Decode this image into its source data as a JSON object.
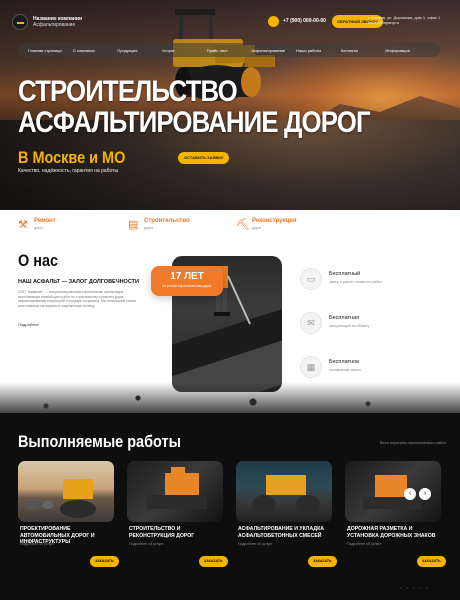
{
  "brand": {
    "name": "Название компании",
    "tagline": "Асфальтирование"
  },
  "header": {
    "phone": "+7 (900) 000-00-00",
    "call_button": "ОБРАТНЫЙ ЗВОНОК",
    "address": "г. Москва, ул. Дорожная, дом 1, офис 1\ninfo@company.ru"
  },
  "nav": [
    "Главная страница",
    "О компании",
    "Продукция",
    "Услуги",
    "Прайс-лист",
    "Асфальтирование",
    "Наши работы",
    "Контакты",
    "Информация"
  ],
  "hero": {
    "title_line1": "СТРОИТЕЛЬСТВО",
    "title_line2": "АСФАЛЬТИРОВАНИЕ ДОРОГ",
    "subtitle": "В Москве и МО",
    "order_button": "ОСТАВИТЬ ЗАЯВКУ",
    "tagline": "Качество, надёжность, гарантия на работы"
  },
  "features": [
    {
      "title": "Ремонт",
      "sub": "дорог",
      "icon": "hammer-icon"
    },
    {
      "title": "Строительство",
      "sub": "дорог",
      "icon": "road-icon"
    },
    {
      "title": "Реконструкция",
      "sub": "дорог",
      "icon": "crane-icon"
    }
  ],
  "about": {
    "heading": "О нас",
    "subheading": "НАШ АСФАЛЬТ — ЗАЛОГ ДОЛГОВЕЧНОСТИ",
    "text": "ООО \"Название\" — специализированная строительная организация, выполняющая полный цикл работ по строительству и ремонту дорог, асфальтированию территорий, площадок и парковок. Мы используем только качественные материалы и современную технику.",
    "more": "Подробнее",
    "years_number": "17 ЛЕТ",
    "years_label": "на рынке строительства дорог",
    "benefits": [
      {
        "title": "Бесплатный",
        "sub": "замер и расчёт стоимости работ",
        "icon": "ruler-icon"
      },
      {
        "title": "Бесплатная",
        "sub": "консультация по объекту",
        "icon": "chat-icon"
      },
      {
        "title": "Бесплатное",
        "sub": "составление сметы",
        "icon": "document-icon"
      }
    ]
  },
  "works": {
    "heading": "Выполняемые работы",
    "all_link": "Весь перечень выполняемых работ",
    "cards": [
      {
        "title": "ПРОЕКТИРОВАНИЕ АВТОМОБИЛЬНЫХ ДОРОГ И ИНФРАСТРУКТУРЫ",
        "sub": "Подробнее об услуге",
        "button": "ЗАКАЗАТЬ"
      },
      {
        "title": "СТРОИТЕЛЬСТВО И РЕКОНСТРУКЦИЯ ДОРОГ",
        "sub": "Подробнее об услуге",
        "button": "ЗАКАЗАТЬ"
      },
      {
        "title": "АСФАЛЬТИРОВАНИЕ И УКЛАДКА АСФАЛЬТОБЕТОННЫХ СМЕСЕЙ",
        "sub": "Подробнее об услуге",
        "button": "ЗАКАЗАТЬ"
      },
      {
        "title": "ДОРОЖНАЯ РАЗМЕТКА И УСТАНОВКА ДОРОЖНЫХ ЗНАКОВ",
        "sub": "Подробнее об услуге",
        "button": "ЗАКАЗАТЬ"
      }
    ],
    "prev": "‹",
    "next": "›"
  },
  "colors": {
    "accent": "#f5b400",
    "orange": "#f27b2a",
    "dark": "#0e0e0e"
  }
}
